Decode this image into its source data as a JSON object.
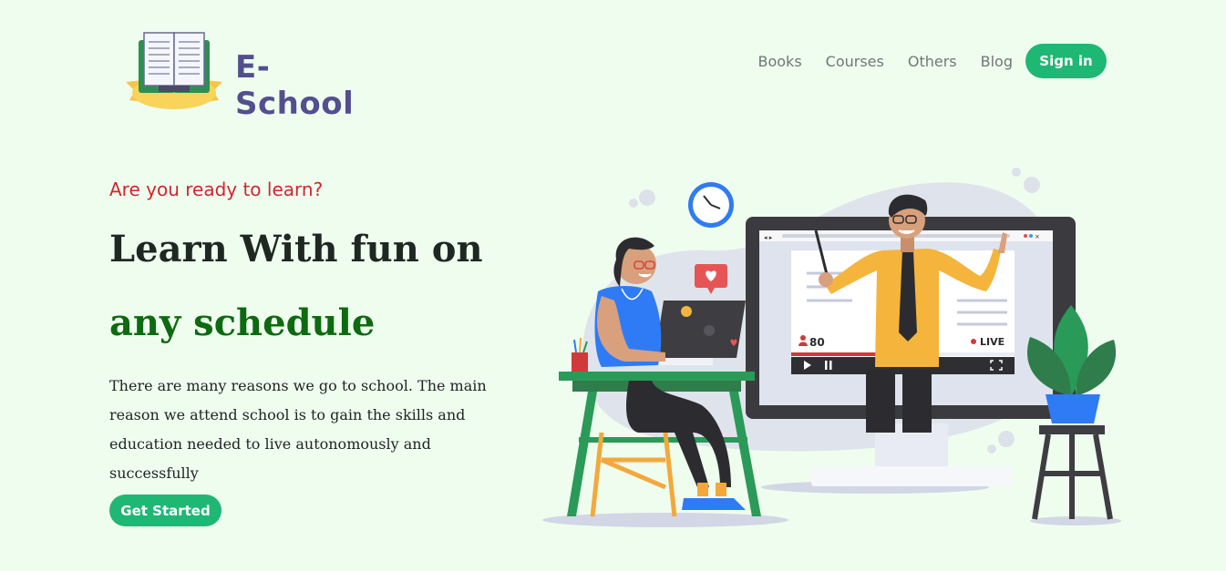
{
  "brand": {
    "name": "E- School"
  },
  "nav": {
    "items": [
      {
        "label": "Books"
      },
      {
        "label": "Courses"
      },
      {
        "label": "Others"
      },
      {
        "label": "Blog"
      }
    ],
    "signin_label": "Sign in"
  },
  "hero": {
    "tagline": "Are you ready to learn?",
    "headline_line1": "Learn With fun on",
    "headline_line2": "any schedule",
    "description": "There are many reasons we go to school. The main reason we attend school is to gain the skills and education needed to live autonomously and successfully",
    "cta_label": "Get Started"
  },
  "illustration": {
    "viewer_count": "80",
    "live_label": "LIVE"
  },
  "colors": {
    "background": "#effdef",
    "accent": "#1fb774",
    "brand_text": "#534f8f",
    "tagline": "#d1262c",
    "headline_green": "#0e6a10"
  },
  "icons": [
    "book-logo-icon",
    "clock-icon",
    "heart-icon",
    "play-icon",
    "pause-icon",
    "fullscreen-icon",
    "user-icon"
  ]
}
